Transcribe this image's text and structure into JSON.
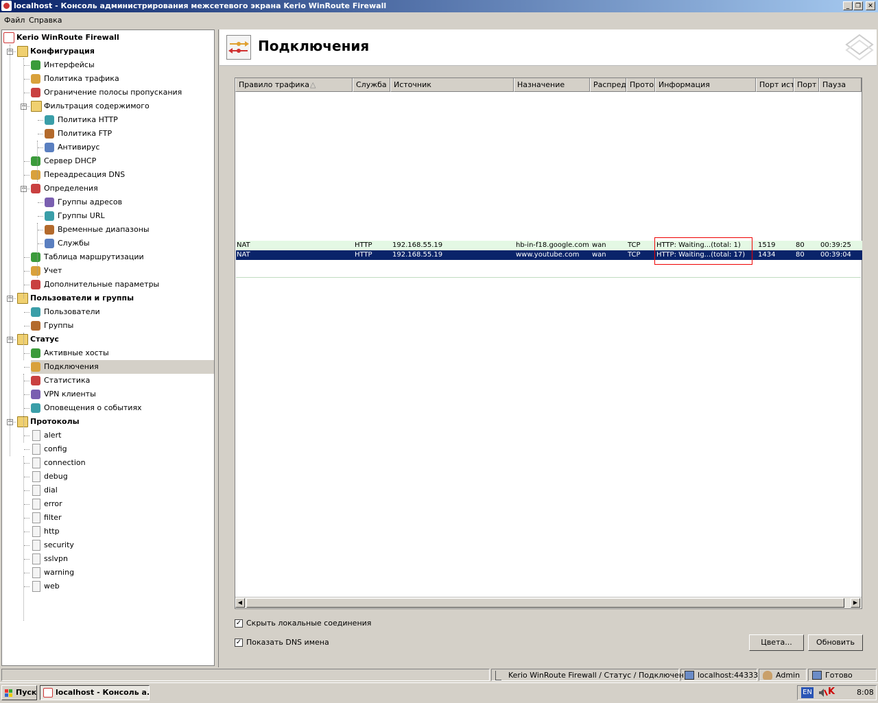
{
  "window": {
    "title": "localhost - Консоль администрирования межсетевого экрана Kerio WinRoute Firewall"
  },
  "menu": {
    "file": "Файл",
    "help": "Справка"
  },
  "tree": {
    "root": "Kerio WinRoute Firewall",
    "items": [
      {
        "label": "Конфигурация",
        "bold": true,
        "level": 1,
        "icon": "folder-gear-icon"
      },
      {
        "label": "Интерфейсы",
        "level": 2,
        "icon": "network-card-icon"
      },
      {
        "label": "Политика трафика",
        "level": 2,
        "icon": "traffic-policy-icon"
      },
      {
        "label": "Ограничение полосы пропускания",
        "level": 2,
        "icon": "bandwidth-limit-icon"
      },
      {
        "label": "Фильтрация содержимого",
        "level": 2,
        "icon": "folder-filter-icon"
      },
      {
        "label": "Политика HTTP",
        "level": 3,
        "icon": "http-policy-icon"
      },
      {
        "label": "Политика FTP",
        "level": 3,
        "icon": "ftp-policy-icon"
      },
      {
        "label": "Антивирус",
        "level": 3,
        "icon": "antivirus-icon"
      },
      {
        "label": "Сервер DHCP",
        "level": 2,
        "icon": "dhcp-server-icon"
      },
      {
        "label": "Переадресация DNS",
        "level": 2,
        "icon": "dns-forwarding-icon"
      },
      {
        "label": "Определения",
        "level": 2,
        "icon": "definitions-icon"
      },
      {
        "label": "Группы адресов",
        "level": 3,
        "icon": "address-groups-icon"
      },
      {
        "label": "Группы URL",
        "level": 3,
        "icon": "url-groups-icon"
      },
      {
        "label": "Временные диапазоны",
        "level": 3,
        "icon": "time-ranges-icon"
      },
      {
        "label": "Службы",
        "level": 3,
        "icon": "services-icon"
      },
      {
        "label": "Таблица маршрутизации",
        "level": 2,
        "icon": "routing-table-icon"
      },
      {
        "label": "Учет",
        "level": 2,
        "icon": "accounting-icon"
      },
      {
        "label": "Дополнительные параметры",
        "level": 2,
        "icon": "advanced-settings-icon"
      },
      {
        "label": "Пользователи и группы",
        "bold": true,
        "level": 1,
        "icon": "users-groups-folder-icon"
      },
      {
        "label": "Пользователи",
        "level": 2,
        "icon": "user-icon"
      },
      {
        "label": "Группы",
        "level": 2,
        "icon": "group-icon"
      },
      {
        "label": "Статус",
        "bold": true,
        "level": 1,
        "icon": "status-folder-icon"
      },
      {
        "label": "Активные хосты",
        "level": 2,
        "icon": "active-hosts-icon"
      },
      {
        "label": "Подключения",
        "level": 2,
        "icon": "connections-icon",
        "selected": true
      },
      {
        "label": "Статистика",
        "level": 2,
        "icon": "statistics-icon"
      },
      {
        "label": "VPN клиенты",
        "level": 2,
        "icon": "vpn-clients-icon"
      },
      {
        "label": "Оповещения о событиях",
        "level": 2,
        "icon": "warning-icon"
      },
      {
        "label": "Протоколы",
        "bold": true,
        "level": 1,
        "icon": "logs-folder-icon"
      },
      {
        "label": "alert",
        "level": 2,
        "icon": "log-alert-icon"
      },
      {
        "label": "config",
        "level": 2,
        "icon": "log-config-icon"
      },
      {
        "label": "connection",
        "level": 2,
        "icon": "log-connection-icon"
      },
      {
        "label": "debug",
        "level": 2,
        "icon": "log-debug-icon"
      },
      {
        "label": "dial",
        "level": 2,
        "icon": "log-dial-icon"
      },
      {
        "label": "error",
        "level": 2,
        "icon": "log-error-icon"
      },
      {
        "label": "filter",
        "level": 2,
        "icon": "log-filter-icon"
      },
      {
        "label": "http",
        "level": 2,
        "icon": "log-http-icon"
      },
      {
        "label": "security",
        "level": 2,
        "icon": "log-security-icon"
      },
      {
        "label": "sslvpn",
        "level": 2,
        "icon": "log-sslvpn-icon"
      },
      {
        "label": "warning",
        "level": 2,
        "icon": "log-warning-icon"
      },
      {
        "label": "web",
        "level": 2,
        "icon": "log-web-icon"
      }
    ]
  },
  "page": {
    "title": "Подключения"
  },
  "table": {
    "columns": [
      {
        "label": "Правило трафика"
      },
      {
        "label": "Служба"
      },
      {
        "label": "Источник"
      },
      {
        "label": "Назначение"
      },
      {
        "label": "Распреде"
      },
      {
        "label": "Протокол"
      },
      {
        "label": "Информация"
      },
      {
        "label": "Порт исто"
      },
      {
        "label": "Порт н"
      },
      {
        "label": "Пауза"
      }
    ],
    "rows": [
      {
        "rule": "NAT",
        "service": "HTTP",
        "source": "192.168.55.19",
        "destination": "hb-in-f18.google.com",
        "distr": "wan",
        "protocol": "TCP",
        "info": "HTTP: Waiting...(total: 1)",
        "src_port": "1519",
        "dst_port": "80",
        "idle": "00:39:25"
      },
      {
        "rule": "NAT",
        "service": "HTTP",
        "source": "192.168.55.19",
        "destination": "www.youtube.com",
        "distr": "wan",
        "protocol": "TCP",
        "info": "HTTP: Waiting...(total: 17)",
        "src_port": "1434",
        "dst_port": "80",
        "idle": "00:39:04"
      }
    ]
  },
  "options": {
    "hide_local": "Скрыть локальные соединения",
    "show_dns": "Показать DNS имена"
  },
  "buttons": {
    "colors": "Цвета...",
    "refresh": "Обновить"
  },
  "status": {
    "path": "Kerio WinRoute Firewall / Статус / Подключения",
    "server": "localhost:44333",
    "user": "Admin",
    "state": "Готово"
  },
  "taskbar": {
    "start": "Пуск",
    "task": "localhost - Консоль а...",
    "lang": "EN",
    "clock": "8:08"
  },
  "colors": {
    "selection": "#0a246a",
    "row_local": "#e4f8e4",
    "highlight_box": "#ee0000"
  }
}
